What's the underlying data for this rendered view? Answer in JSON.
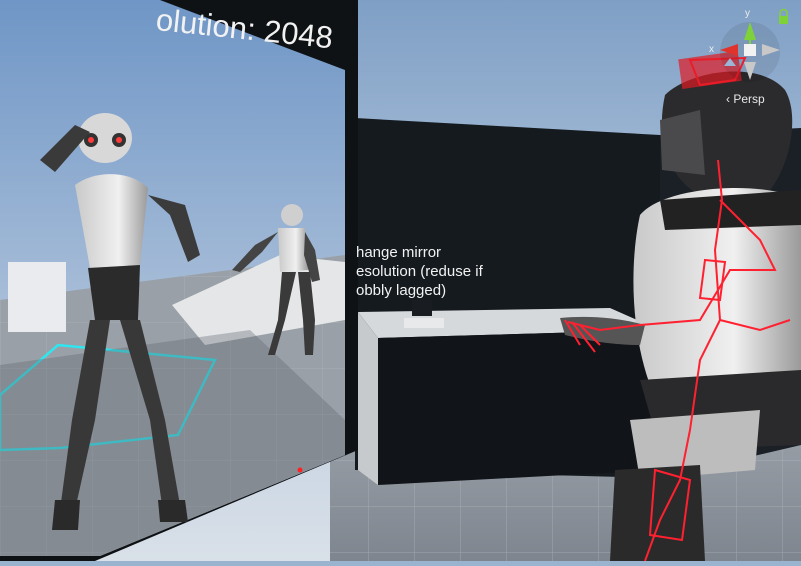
{
  "viewport": {
    "mirror_resolution_label": "olution: 2048",
    "instruction_lines": [
      "hange mirror",
      "esolution (reduse if",
      "obbly lagged)"
    ]
  },
  "gizmo": {
    "axis_x": "x",
    "axis_y": "y",
    "projection_label": "Persp"
  },
  "colors": {
    "sky": "#9ab3cf",
    "floor": "#8e949c",
    "panel_dark": "#101418",
    "bone_overlay": "#ff2030",
    "play_area": "#2ee6f0",
    "gizmo_y": "#7fd13a",
    "gizmo_x": "#e0332b"
  },
  "icons": [
    "scene-gizmo-icon",
    "lock-icon"
  ]
}
